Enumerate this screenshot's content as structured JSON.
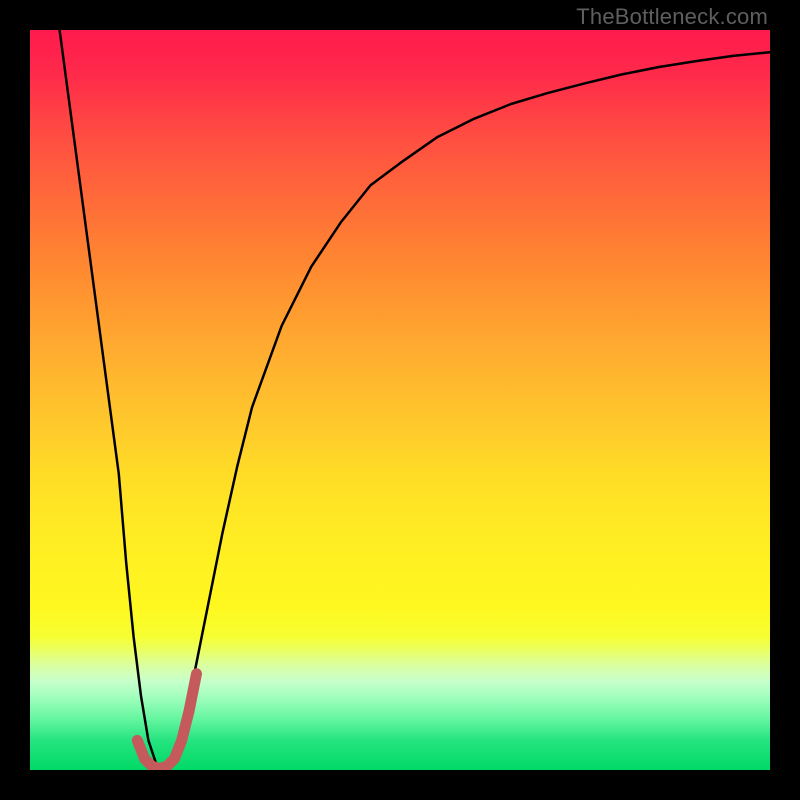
{
  "watermark": "TheBottleneck.com",
  "chart_data": {
    "type": "line",
    "title": "",
    "xlabel": "",
    "ylabel": "",
    "xlim": [
      0,
      100
    ],
    "ylim": [
      0,
      100
    ],
    "grid": false,
    "background": "rainbow-vertical-gradient",
    "series": [
      {
        "name": "black-curve",
        "color": "#000000",
        "stroke_width": 2.5,
        "x": [
          4,
          6,
          8,
          10,
          12,
          13,
          14,
          15,
          16,
          17,
          18,
          19,
          20,
          22,
          24,
          26,
          28,
          30,
          34,
          38,
          42,
          46,
          50,
          55,
          60,
          65,
          70,
          75,
          80,
          85,
          90,
          95,
          100
        ],
        "values": [
          100,
          85,
          70,
          55,
          40,
          28,
          18,
          10,
          4,
          1,
          0,
          1,
          4,
          12,
          22,
          32,
          41,
          49,
          60,
          68,
          74,
          79,
          82,
          85.5,
          88,
          90,
          91.5,
          92.8,
          94,
          95,
          95.8,
          96.5,
          97
        ]
      },
      {
        "name": "red-hook",
        "color": "#c55a5c",
        "stroke_width": 11,
        "x": [
          14.5,
          15.5,
          16.5,
          17.5,
          18.5,
          19.5,
          20.5,
          21.5,
          22.5
        ],
        "values": [
          4,
          1.5,
          0.5,
          0.2,
          0.5,
          1.5,
          4,
          8,
          13
        ]
      }
    ],
    "annotations": []
  }
}
